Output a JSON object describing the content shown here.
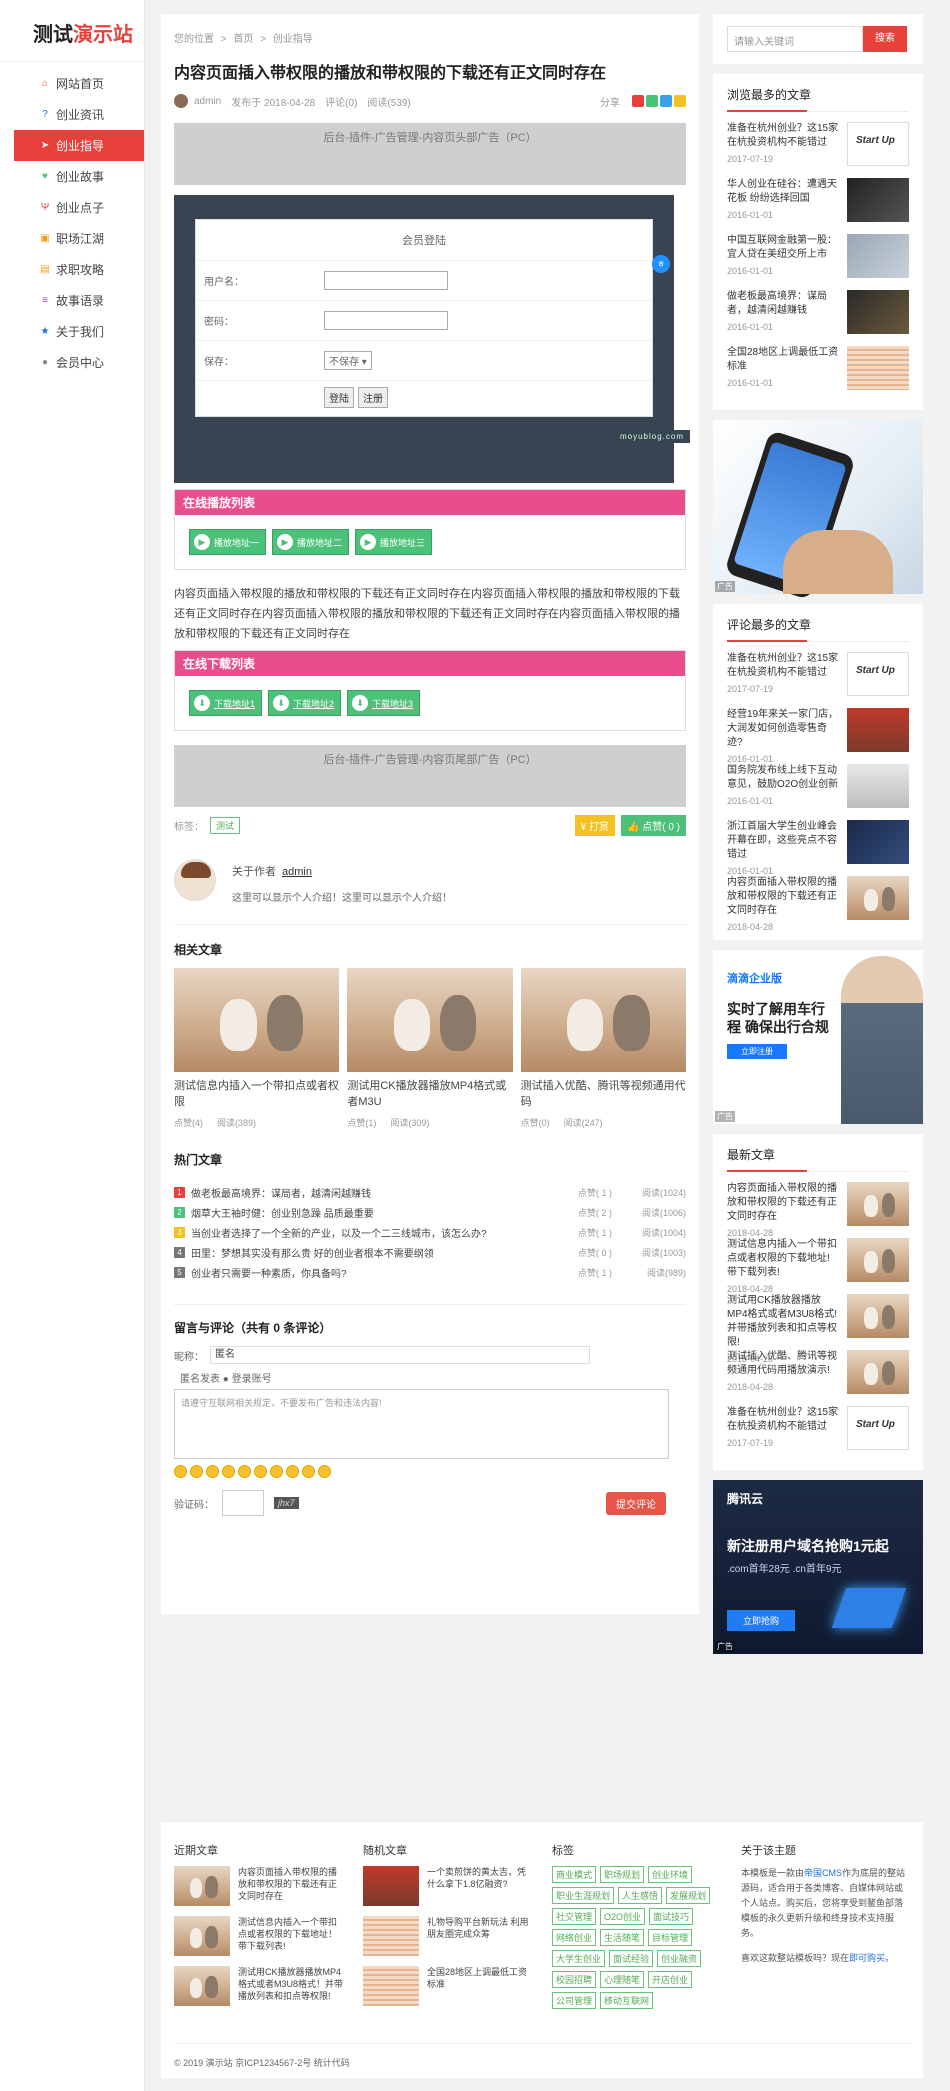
{
  "site": {
    "logo_a": "测试",
    "logo_b": "演示站"
  },
  "nav": [
    {
      "label": "网站首页",
      "icon": "home-icon",
      "glyph": "⌂",
      "color": "#e8413b"
    },
    {
      "label": "创业资讯",
      "icon": "question-icon",
      "glyph": "?",
      "color": "#1e6fd9"
    },
    {
      "label": "创业指导",
      "icon": "paper-plane-icon",
      "glyph": "➤",
      "color": "#ffffff"
    },
    {
      "label": "创业故事",
      "icon": "heart-icon",
      "glyph": "♥",
      "color": "#4cc17a"
    },
    {
      "label": "创业点子",
      "icon": "cutlery-icon",
      "glyph": "Ψ",
      "color": "#e8413b"
    },
    {
      "label": "职场江湖",
      "icon": "ticket-icon",
      "glyph": "▣",
      "color": "#f39c12"
    },
    {
      "label": "求职攻略",
      "icon": "file-icon",
      "glyph": "▤",
      "color": "#f39c12"
    },
    {
      "label": "故事语录",
      "icon": "list-icon",
      "glyph": "≡",
      "color": "#9b3bd1"
    },
    {
      "label": "关于我们",
      "icon": "star-icon",
      "glyph": "★",
      "color": "#1e6fd9"
    },
    {
      "label": "会员中心",
      "icon": "user-icon",
      "glyph": "●",
      "color": "#888888"
    }
  ],
  "breadcrumb": [
    "您的位置",
    ">",
    "首页",
    ">",
    "创业指导"
  ],
  "article": {
    "title": "内容页面插入带权限的播放和带权限的下载还有正文同时存在",
    "author": "admin",
    "date": "发布于 2018-04-28",
    "comments": "评论(0)",
    "reads": "阅读(539)",
    "share_label": "分享",
    "ad_top": "后台-插件-广告管理-内容页头部广告（PC）",
    "ad_bottom": "后台-插件-广告管理-内容页尾部广告（PC）",
    "body": "内容页面插入带权限的播放和带权限的下载还有正文同时存在内容页面插入带权限的播放和带权限的下载还有正文同时存在内容页面插入带权限的播放和带权限的下载还有正文同时存在内容页面插入带权限的播放和带权限的下载还有正文同时存在"
  },
  "login": {
    "title": "会员登陆",
    "username_label": "用户名：",
    "password_label": "密码：",
    "save_label": "保存：",
    "save_option": "不保存 ▾",
    "login_btn": "登陆",
    "register_btn": "注册",
    "watermark": "moyublog.com",
    "badge": "ㅎ"
  },
  "play": {
    "title": "在线播放列表",
    "buttons": [
      "播放地址一",
      "播放地址二",
      "播放地址三"
    ]
  },
  "download": {
    "title": "在线下载列表",
    "buttons": [
      "下载地址1",
      "下载地址2",
      "下载地址3"
    ]
  },
  "tags": {
    "label": "标签：",
    "items": [
      "测试"
    ],
    "tip": "¥ 打赏",
    "like": "👍 点赞( 0 )"
  },
  "author_box": {
    "label": "关于作者",
    "name": "admin",
    "intro": "这里可以显示个人介绍！这里可以显示个人介绍！"
  },
  "related": {
    "title": "相关文章",
    "items": [
      {
        "title": "测试信息内插入一个带扣点或者权限",
        "likes": "点赞(4)",
        "reads": "阅读(389)"
      },
      {
        "title": "测试用CK播放器播放MP4格式或者M3U",
        "likes": "点赞(1)",
        "reads": "阅读(309)"
      },
      {
        "title": "测试插入优酷、腾讯等视频通用代码",
        "likes": "点赞(0)",
        "reads": "阅读(247)"
      }
    ]
  },
  "hot": {
    "title": "热门文章",
    "items": [
      {
        "n": "1",
        "color": "#e8413b",
        "title": "做老板最高境界：谋局者，越清闲越赚钱",
        "likes": "点赞( 1 )",
        "reads": "阅读(1024)"
      },
      {
        "n": "2",
        "color": "#4cc17a",
        "title": "烟草大王袖时健：创业别急躁 品质最重要",
        "likes": "点赞( 2 )",
        "reads": "阅读(1006)"
      },
      {
        "n": "3",
        "color": "#f4c122",
        "title": "当创业者选择了一个全新的产业，以及一个二三线城市，该怎么办?",
        "likes": "点赞( 1 )",
        "reads": "阅读(1004)"
      },
      {
        "n": "4",
        "color": "#777777",
        "title": "田里：梦想其实没有那么贵 好的创业者根本不需要纲领",
        "likes": "点赞( 0 )",
        "reads": "阅读(1003)"
      },
      {
        "n": "5",
        "color": "#777777",
        "title": "创业者只需要一种素质，你具备吗?",
        "likes": "点赞( 1 )",
        "reads": "阅读(989)"
      }
    ]
  },
  "comment": {
    "title": "留言与评论（共有 0 条评论）",
    "nick_label": "昵称：",
    "nick_value": "匿名",
    "anon": "匿名发表 ● 登录账号",
    "placeholder": "请遵守互联网相关规定，不要发布广告和违法内容!",
    "code_label": "验证码：",
    "code_img": "jhx7",
    "submit": "提交评论"
  },
  "sidebar": {
    "search_placeholder": "请输入关键词",
    "search_btn": "搜索",
    "most_viewed": {
      "title": "浏览最多的文章",
      "items": [
        {
          "title": "准备在杭州创业？这15家在杭投资机构不能错过",
          "date": "2017-07-19",
          "img": "startup"
        },
        {
          "title": "华人创业在硅谷：遭遇天花板 纷纷选择回国",
          "date": "2016-01-01",
          "img": "dark1"
        },
        {
          "title": "中国互联网金融第一股：宜人贷在美纽交所上市",
          "date": "2016-01-01",
          "img": "city"
        },
        {
          "title": "做老板最高境界：谋局者，越清闲越赚钱",
          "date": "2016-01-01",
          "img": "dark2"
        },
        {
          "title": "全国28地区上调最低工资标准",
          "date": "2016-01-01",
          "img": "table-img"
        }
      ]
    },
    "ad1_label": "广告",
    "most_commented": {
      "title": "评论最多的文章",
      "items": [
        {
          "title": "准备在杭州创业？这15家在杭投资机构不能错过",
          "date": "2017-07-19",
          "img": "startup"
        },
        {
          "title": "经营19年来关一家门店，大润发如何创造零售奇迹?",
          "date": "2016-01-01",
          "img": "shop"
        },
        {
          "title": "国务院发布线上线下互动意见，鼓励O2O创业创新",
          "date": "2016-01-01",
          "img": "phone-img"
        },
        {
          "title": "浙江首届大学生创业峰会开幕在即，这些亮点不容错过",
          "date": "2016-01-01",
          "img": "navy"
        },
        {
          "title": "内容页面插入带权限的播放和带权限的下载还有正文同时存在",
          "date": "2018-04-28",
          "img": "thumb"
        }
      ]
    },
    "didi": {
      "brand": "滴滴企业版",
      "headline": "实时了解用车行程 确保出行合规",
      "cta": "立即注册",
      "label": "广告"
    },
    "latest": {
      "title": "最新文章",
      "items": [
        {
          "title": "内容页面插入带权限的播放和带权限的下载还有正文同时存在",
          "date": "2018-04-28",
          "img": "thumb"
        },
        {
          "title": "测试信息内插入一个带扣点或者权限的下载地址! 带下载列表!",
          "date": "2018-04-28",
          "img": "thumb"
        },
        {
          "title": "测试用CK播放器播放MP4格式或者M3U8格式! 并带播放列表和扣点等权限!",
          "date": "2018-04-28",
          "img": "thumb"
        },
        {
          "title": "测试插入优酷、腾讯等视频通用代码用播放演示!",
          "date": "2018-04-28",
          "img": "thumb"
        },
        {
          "title": "准备在杭州创业？这15家在杭投资机构不能错过",
          "date": "2017-07-19",
          "img": "startup"
        }
      ]
    },
    "qcloud": {
      "brand": "腾讯云",
      "headline": "新注册用户域名抢购1元起",
      "sub": ".com首年28元 .cn首年9元",
      "cta": "立即抢购",
      "label": "广告"
    }
  },
  "footer": {
    "recent": {
      "title": "近期文章",
      "items": [
        {
          "title": "内容页面插入带权限的播放和带权限的下载还有正文同时存在",
          "img": "thumb"
        },
        {
          "title": "测试信息内插入一个带扣点或者权限的下载地址！带下载列表!",
          "img": "thumb"
        },
        {
          "title": "测试用CK播放器播放MP4格式或者M3U8格式！并带播放列表和扣点等权限!",
          "img": "thumb"
        }
      ]
    },
    "random": {
      "title": "随机文章",
      "items": [
        {
          "title": "一个卖煎饼的黄太吉，凭什么拿下1.8亿融资?",
          "img": "shop"
        },
        {
          "title": "礼物导购平台新玩法 利用朋友圈完成众筹",
          "img": "table-img"
        },
        {
          "title": "全国28地区上调最低工资标准",
          "img": "table-img"
        }
      ]
    },
    "tags": {
      "title": "标签",
      "items": [
        "商业模式",
        "职场规划",
        "创业环境",
        "职业生涯规划",
        "人生感悟",
        "发展规划",
        "社交管理",
        "O2O创业",
        "面试技巧",
        "网络创业",
        "生活随笔",
        "目标管理",
        "大学生创业",
        "面试经验",
        "创业融资",
        "校园招聘",
        "心理随笔",
        "开店创业",
        "公司管理",
        "移动互联网"
      ]
    },
    "about": {
      "title": "关于该主题",
      "t1": "本模板是一款由",
      "link1": "帝国CMS",
      "t2": "作为底层的整站源码，适合用于各类博客、自媒体网站或个人站点。购买后，您将享受到鳌鱼部落模板的永久更新升级和终身技术支持服务。",
      "t3": "喜欢这款整站模板吗？现在",
      "link2": "即可购买",
      "t4": "。"
    },
    "copyright": "© 2019 演示站 京ICP1234567-2号 统计代码"
  }
}
